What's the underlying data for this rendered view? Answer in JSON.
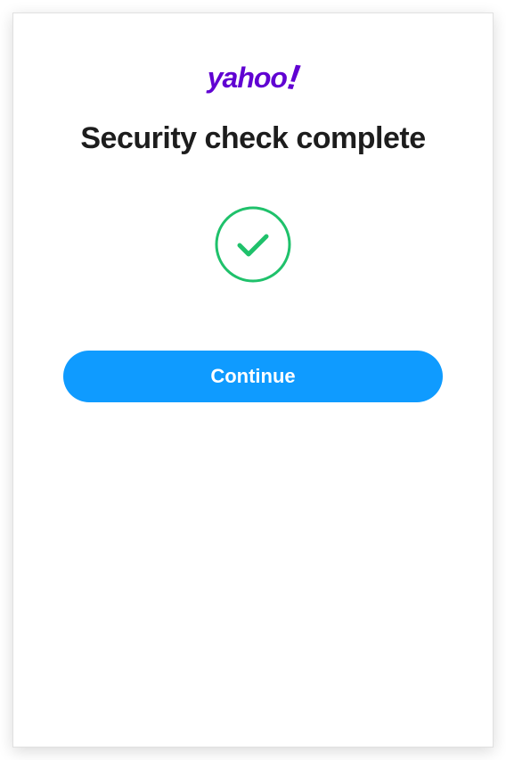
{
  "brand": {
    "name": "yahoo",
    "exclamation": "!"
  },
  "heading": "Security check complete",
  "button": {
    "continue_label": "Continue"
  },
  "colors": {
    "brand_purple": "#6001d2",
    "success_green": "#1fc16b",
    "action_blue": "#0f9bff"
  }
}
